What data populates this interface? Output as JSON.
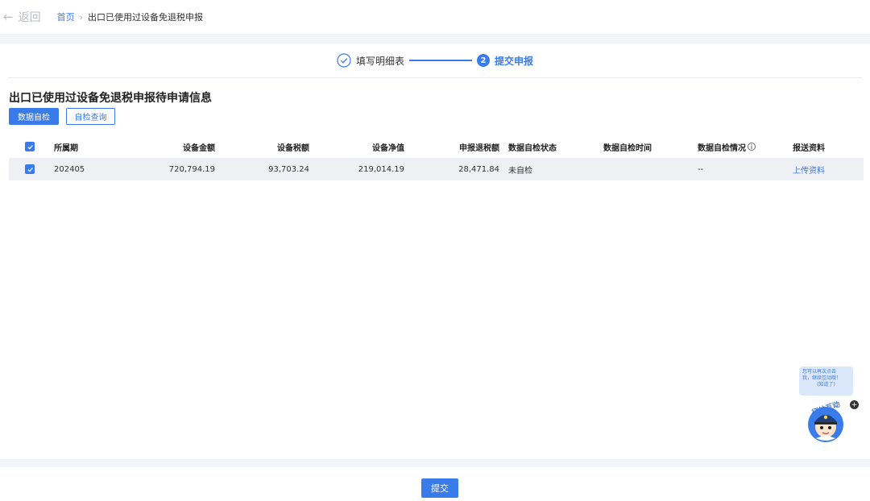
{
  "nav": {
    "back_label": "返回",
    "breadcrumb_home": "首页",
    "breadcrumb_separator": "›",
    "breadcrumb_current": "出口已使用过设备免退税申报"
  },
  "steps": [
    {
      "label": "填写明细表",
      "state": "done"
    },
    {
      "number": "2",
      "label": "提交申报",
      "state": "active"
    }
  ],
  "section": {
    "title": "出口已使用过设备免退税申报待申请信息",
    "data_check_button": "数据自检",
    "check_query_button": "自检查询"
  },
  "table": {
    "headers": [
      "所属期",
      "设备金额",
      "设备税额",
      "设备净值",
      "申报退税额",
      "数据自检状态",
      "数据自检时间",
      "数据自检情况",
      "报送资料"
    ],
    "rows": [
      {
        "period": "202405",
        "equipment_amount": "720,794.19",
        "equipment_tax": "93,703.24",
        "equipment_net_value": "219,014.19",
        "refund_amount": "28,471.84",
        "check_status": "未自检",
        "check_time": "",
        "check_result": "--",
        "materials_link": "上传资料"
      }
    ]
  },
  "assistant": {
    "bubble_line1": "您可以再次点击",
    "bubble_line2": "我，继续互动哦！",
    "bubble_link": "(知道了)",
    "mascot_label": "征纳互动"
  },
  "footer": {
    "submit_label": "提交"
  },
  "colors": {
    "accent": "#3a7bea",
    "page_bg": "#f4f5f8",
    "row_bg": "#eef0f4"
  }
}
